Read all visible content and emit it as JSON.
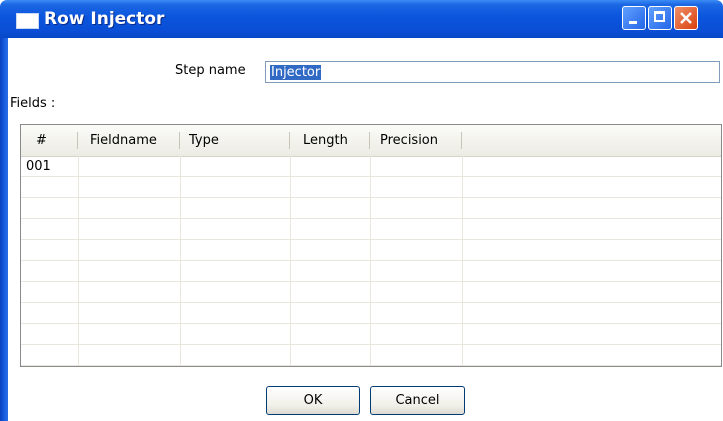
{
  "window": {
    "title": "Row Injector",
    "controls": {
      "minimize": "minimize-icon",
      "maximize": "maximize-icon",
      "close": "close-icon"
    }
  },
  "form": {
    "step_name_label": "Step name",
    "step_name_value": "Injector",
    "fields_label": "Fields :"
  },
  "grid": {
    "columns": [
      "#",
      "Fieldname",
      "Type",
      "Length",
      "Precision"
    ],
    "rows": [
      {
        "num": "001",
        "fieldname": "",
        "type": "",
        "length": "",
        "precision": ""
      }
    ]
  },
  "buttons": {
    "ok": "OK",
    "cancel": "Cancel"
  },
  "colors": {
    "titlebar": "#0a55dc",
    "selection": "#316ac5",
    "close_button": "#d9400c"
  }
}
